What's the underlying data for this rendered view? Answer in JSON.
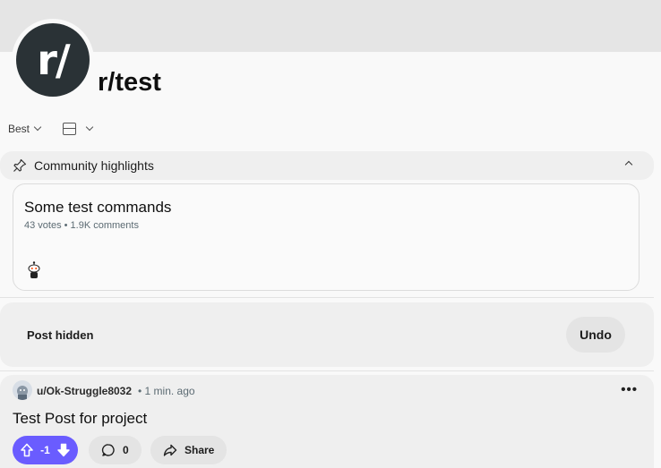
{
  "subreddit": {
    "avatar_text": "r/",
    "name": "r/test"
  },
  "feed_controls": {
    "sort_label": "Best"
  },
  "highlights": {
    "label": "Community highlights",
    "card": {
      "title": "Some test commands",
      "meta": "43 votes • 1.9K comments"
    }
  },
  "hidden_post": {
    "label": "Post hidden",
    "undo_label": "Undo"
  },
  "post": {
    "author": "u/Ok-Struggle8032",
    "time": "• 1 min. ago",
    "more_label": "•••",
    "title": "Test Post for project",
    "score": "-1",
    "comment_count": "0",
    "share_label": "Share"
  },
  "colors": {
    "vote_accent": "#6a5cff",
    "avatar_bg": "#2a3236",
    "banner": "#e5e5e5"
  },
  "icons": [
    "pin-icon",
    "chevron-down-icon",
    "chevron-up-icon",
    "layout-icon",
    "upvote-icon",
    "downvote-icon",
    "comment-icon",
    "share-icon",
    "more-icon"
  ]
}
